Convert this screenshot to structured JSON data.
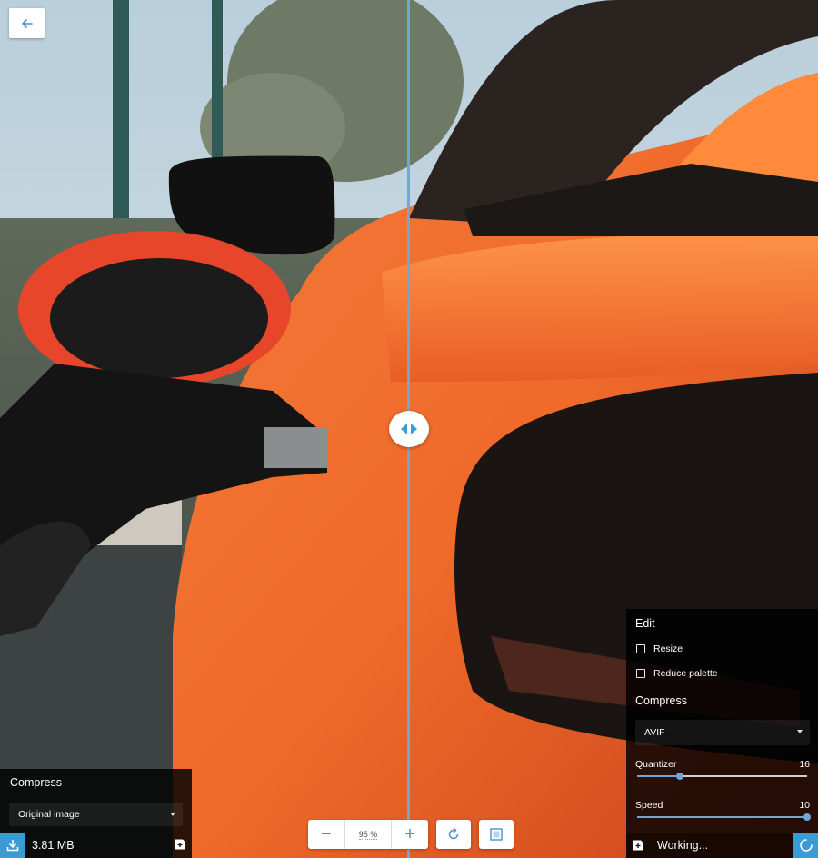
{
  "back": {
    "icon": "arrow-left-icon"
  },
  "left_panel": {
    "heading": "Compress",
    "select_value": "Original image",
    "file_size": "3.81 MB"
  },
  "zoom": {
    "minus": "−",
    "value": "95 %",
    "plus": "+"
  },
  "right_panel": {
    "edit_heading": "Edit",
    "options": [
      {
        "label": "Resize",
        "checked": false
      },
      {
        "label": "Reduce palette",
        "checked": false
      }
    ],
    "compress_heading": "Compress",
    "format_value": "AVIF",
    "sliders": [
      {
        "label": "Quantizer",
        "value": "16",
        "fraction": 0.25
      },
      {
        "label": "Speed",
        "value": "10",
        "fraction": 1.0
      }
    ],
    "status": "Working..."
  },
  "colors": {
    "accent": "#3b9bd3",
    "divider": "#6fa7d8"
  }
}
